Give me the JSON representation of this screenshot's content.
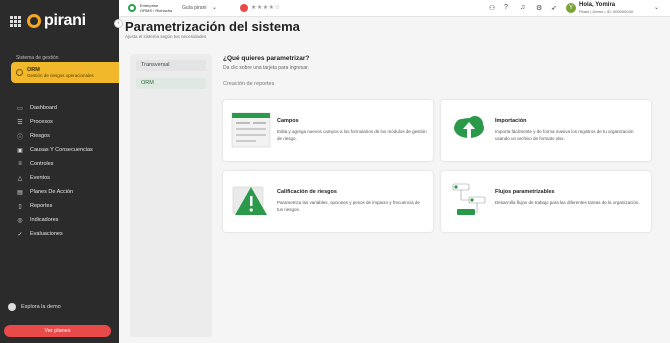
{
  "app": {
    "logo_text": "pirani"
  },
  "sidebar": {
    "section_label": "Sistema de gestión",
    "module": {
      "title": "ORM",
      "subtitle": "Gestión de riesgos operacionales"
    },
    "items": [
      {
        "label": "Dashboard",
        "icon": "monitor-icon"
      },
      {
        "label": "Procesos",
        "icon": "list-icon"
      },
      {
        "label": "Riesgos",
        "icon": "alert-circle-icon"
      },
      {
        "label": "Causas Y Consecuencias",
        "icon": "book-icon"
      },
      {
        "label": "Controles",
        "icon": "sliders-icon"
      },
      {
        "label": "Eventos",
        "icon": "warning-icon"
      },
      {
        "label": "Planes De Acción",
        "icon": "clipboard-icon"
      },
      {
        "label": "Reportes",
        "icon": "document-icon"
      },
      {
        "label": "Indicadores",
        "icon": "target-icon"
      },
      {
        "label": "Evaluaciones",
        "icon": "checklist-icon"
      }
    ],
    "explore_label": "Explora la demo",
    "plans_button": "Ver planes"
  },
  "topbar": {
    "company_name": "Enterprise",
    "company_sub": "ORMS / Riohacha",
    "guide_label": "Guía pirani",
    "user_greeting": "Hola, Yomira",
    "user_id": "Pirani | Demo • ID: 00000004X",
    "avatar_initial": "Y"
  },
  "main": {
    "title": "Parametrización del sistema",
    "subtitle": "Ajusta el sistema según tus necesidades",
    "tabs": [
      {
        "label": "Transversal"
      },
      {
        "label": "ORM"
      }
    ],
    "question": "¿Qué quieres parametrizar?",
    "question_sub": "Da clic sobre una tarjeta para ingresar.",
    "group_label": "Creación de reportes",
    "cards": [
      {
        "title": "Campos",
        "description": "Edita y agrega nuevos campos a los formularios de los módulos de gestión de riesgo."
      },
      {
        "title": "Importación",
        "description": "Importa fácilmente y de forma masiva los registros de tu organización usando un archivo de formato xlsx."
      },
      {
        "title": "Calificación de riesgos",
        "description": "Parametriza las variables, opciones y pesos de impacto y frecuencia de tus riesgos."
      },
      {
        "title": "Flujos parametrizables",
        "description": "Desarrolla flujos de trabajo para las diferentes tareas de la organización."
      }
    ]
  },
  "colors": {
    "accent": "#f0b82a",
    "brand_green": "#2aa14a",
    "danger": "#e84a4a"
  }
}
